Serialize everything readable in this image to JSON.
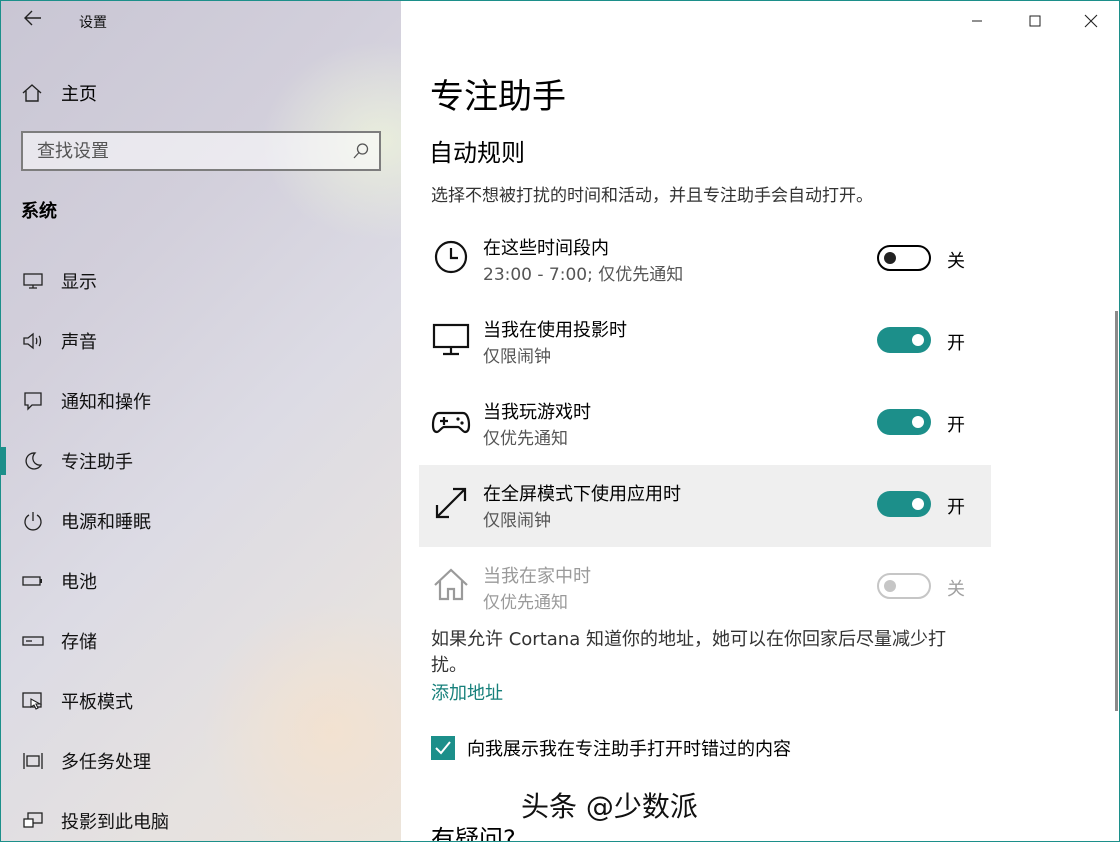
{
  "window": {
    "title": "设置",
    "accent_color": "#1c8f8a",
    "link_color": "#17807b"
  },
  "sidebar": {
    "home_label": "主页",
    "search_placeholder": "查找设置",
    "section_title": "系统",
    "items": [
      {
        "label": "显示",
        "icon": "display-icon",
        "selected": false
      },
      {
        "label": "声音",
        "icon": "speaker-icon",
        "selected": false
      },
      {
        "label": "通知和操作",
        "icon": "notification-icon",
        "selected": false
      },
      {
        "label": "专注助手",
        "icon": "moon-icon",
        "selected": true
      },
      {
        "label": "电源和睡眠",
        "icon": "power-icon",
        "selected": false
      },
      {
        "label": "电池",
        "icon": "battery-icon",
        "selected": false
      },
      {
        "label": "存储",
        "icon": "storage-icon",
        "selected": false
      },
      {
        "label": "平板模式",
        "icon": "tablet-icon",
        "selected": false
      },
      {
        "label": "多任务处理",
        "icon": "multitask-icon",
        "selected": false
      },
      {
        "label": "投影到此电脑",
        "icon": "project-icon",
        "selected": false
      }
    ]
  },
  "main": {
    "page_title": "专注助手",
    "section_title": "自动规则",
    "description": "选择不想被打扰的时间和活动，并且专注助手会自动打开。",
    "rules": [
      {
        "title": "在这些时间段内",
        "subtitle": "23:00 - 7:00; 仅优先通知",
        "on": false,
        "state_label": "关",
        "icon": "clock-icon",
        "disabled": false
      },
      {
        "title": "当我在使用投影时",
        "subtitle": "仅限闹钟",
        "on": true,
        "state_label": "开",
        "icon": "monitor-icon",
        "disabled": false
      },
      {
        "title": "当我玩游戏时",
        "subtitle": "仅优先通知",
        "on": true,
        "state_label": "开",
        "icon": "gamepad-icon",
        "disabled": false
      },
      {
        "title": "在全屏模式下使用应用时",
        "subtitle": "仅限闹钟",
        "on": true,
        "state_label": "开",
        "icon": "fullscreen-icon",
        "disabled": false
      },
      {
        "title": "当我在家中时",
        "subtitle": "仅优先通知",
        "on": false,
        "state_label": "关",
        "icon": "home-icon",
        "disabled": true
      }
    ],
    "cortana_note": "如果允许 Cortana 知道你的地址，她可以在你回家后尽量减少打扰。",
    "add_address_link": "添加地址",
    "checkbox_label": "向我展示我在专注助手打开时错过的内容",
    "checkbox_checked": true,
    "help_title": "有疑问?"
  },
  "watermark": "头条 @少数派"
}
